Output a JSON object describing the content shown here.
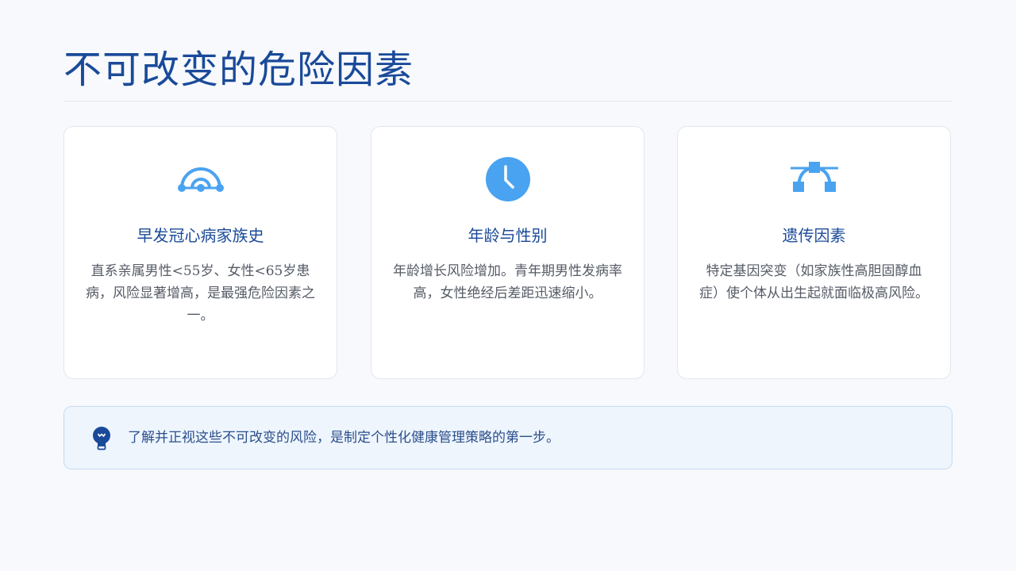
{
  "page": {
    "title": "不可改变的危险因素"
  },
  "cards": [
    {
      "icon": "family-tree-icon",
      "title": "早发冠心病家族史",
      "body": "直系亲属男性<55岁、女性<65岁患病，风险显著增高，是最强危险因素之一。"
    },
    {
      "icon": "clock-icon",
      "title": "年龄与性别",
      "body": "年龄增长风险增加。青年期男性发病率高，女性绝经后差距迅速缩小。"
    },
    {
      "icon": "bezier-curve-icon",
      "title": "遗传因素",
      "body": "特定基因突变（如家族性高胆固醇血症）使个体从出生起就面临极高风险。"
    }
  ],
  "callout": {
    "icon": "lightbulb-icon",
    "text": "了解并正视这些不可改变的风险，是制定个性化健康管理策略的第一步。"
  },
  "colors": {
    "primary": "#1a4a99",
    "icon_accent": "#4aa3f0",
    "background": "#f7f9fc",
    "callout_bg": "#eef5fd"
  }
}
